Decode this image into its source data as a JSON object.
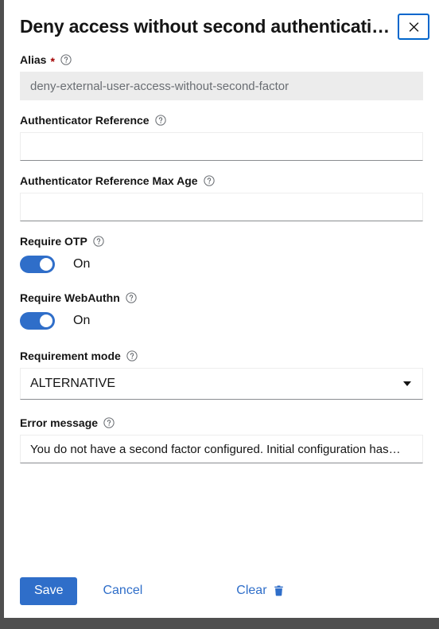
{
  "theme": {
    "backdrop": "#4f4f4f",
    "modal_bg": "#ffffff",
    "accent_blue": "#2f6ec9",
    "focus_blue": "#0066cc",
    "required_red": "#a30000",
    "disabled_bg": "#ececec",
    "text_dark": "#151515",
    "input_bottom_border": "#8a8d90"
  },
  "modal": {
    "title": "Deny access without second authenticati…",
    "close_label": "×",
    "close_icon": "close-icon"
  },
  "fields": {
    "alias": {
      "label": "Alias",
      "required_marker": "*",
      "help_icon": "help-circle-icon",
      "value": "deny-external-user-access-without-second-factor",
      "disabled": true
    },
    "authenticator_reference": {
      "label": "Authenticator Reference",
      "help_icon": "help-circle-icon",
      "value": "",
      "placeholder": ""
    },
    "authenticator_reference_max_age": {
      "label": "Authenticator Reference Max Age",
      "help_icon": "help-circle-icon",
      "value": "",
      "placeholder": ""
    },
    "require_otp": {
      "label": "Require OTP",
      "help_icon": "help-circle-icon",
      "state_label": "On",
      "checked": true
    },
    "require_webauthn": {
      "label": "Require WebAuthn",
      "help_icon": "help-circle-icon",
      "state_label": "On",
      "checked": true
    },
    "requirement_mode": {
      "label": "Requirement mode",
      "help_icon": "help-circle-icon",
      "selected": "ALTERNATIVE",
      "caret_icon": "chevron-down-icon"
    },
    "error_message": {
      "label": "Error message",
      "help_icon": "help-circle-icon",
      "value": "You do not have a second factor configured. Initial configuration has…"
    }
  },
  "footer": {
    "save_label": "Save",
    "cancel_label": "Cancel",
    "clear_label": "Clear",
    "clear_icon": "trash-icon"
  }
}
